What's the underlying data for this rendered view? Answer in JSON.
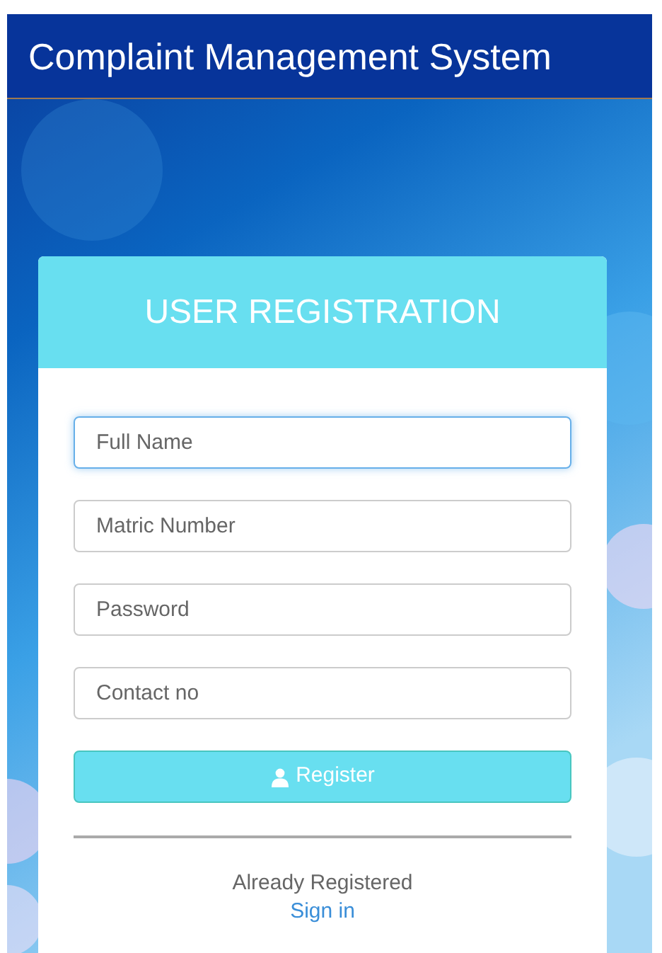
{
  "header": {
    "title": "Complaint Management System"
  },
  "card": {
    "title": "USER REGISTRATION",
    "fields": [
      {
        "placeholder": "Full Name",
        "focused": true
      },
      {
        "placeholder": "Matric Number",
        "focused": false
      },
      {
        "placeholder": "Password",
        "focused": false
      },
      {
        "placeholder": "Contact no",
        "focused": false
      }
    ],
    "button": "Register",
    "footer_text": "Already Registered",
    "link": "Sign in"
  }
}
